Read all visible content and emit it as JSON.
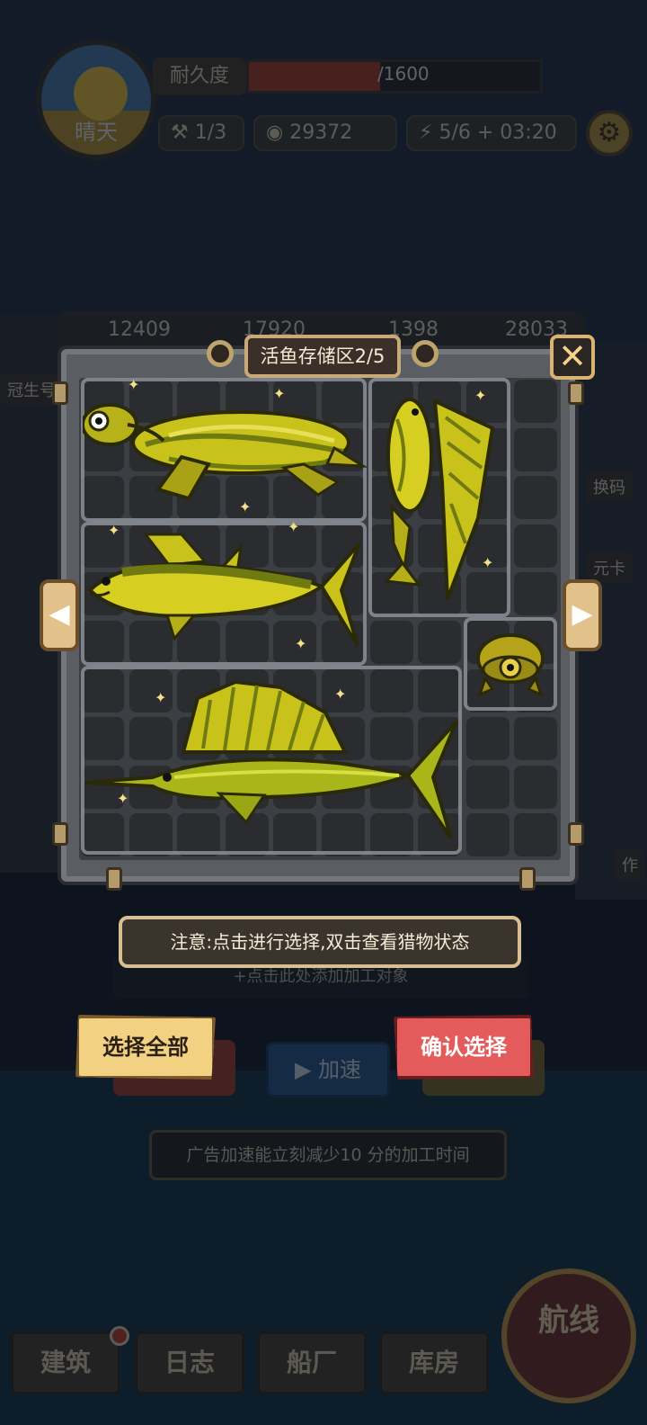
{
  "background": {
    "weather_label": "晴天",
    "durability_label": "耐久度",
    "durability_value": "/1600",
    "durability_fraction": 0.45,
    "crew": "1/3",
    "money": "29372",
    "energy": "5/6",
    "energy_timer": "03:20",
    "resources": [
      "12409",
      "17920",
      "1398",
      "28033"
    ],
    "side_tabs": [
      "冠生号",
      "换码",
      "元卡",
      "作"
    ],
    "process_placeholder": "+点击此处添加加工对象",
    "speed_label": "加速",
    "ad_tip": "广告加速能立刻减少10 分的加工时间",
    "nav": [
      "建筑",
      "日志",
      "船厂",
      "库房"
    ],
    "route_label": "航线"
  },
  "modal": {
    "title": "活鱼存储区2/5",
    "close_symbol": "✕",
    "prev_symbol": "◀",
    "next_symbol": "▶",
    "creatures": [
      "leatherback-turtle",
      "flying-fish",
      "tuna",
      "sailfish",
      "mata-mata-turtle"
    ],
    "notice": "注意:点击进行选择,双击查看猎物状态",
    "select_all": "选择全部",
    "confirm": "确认选择"
  },
  "colors": {
    "creature_gold": "#c9c21a",
    "creature_dark": "#6f7a10",
    "select_all_bg": "#f3d183",
    "confirm_bg": "#e35b5a"
  }
}
